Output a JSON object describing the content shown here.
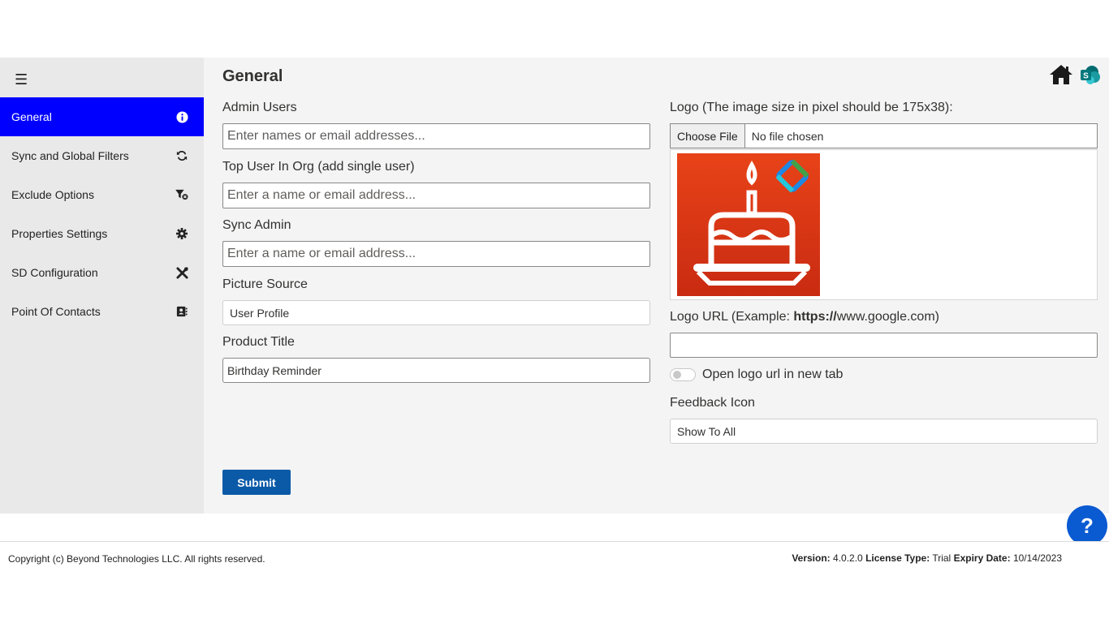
{
  "sidebar": {
    "menu_icon": "hamburger-menu-icon",
    "items": [
      {
        "label": "General",
        "icon": "info-icon",
        "active": true
      },
      {
        "label": "Sync and Global Filters",
        "icon": "refresh-icon"
      },
      {
        "label": "Exclude Options",
        "icon": "filter-clear-icon"
      },
      {
        "label": "Properties Settings",
        "icon": "gear-icon"
      },
      {
        "label": "SD Configuration",
        "icon": "tools-icon"
      },
      {
        "label": "Point Of Contacts",
        "icon": "contact-card-icon"
      }
    ]
  },
  "header": {
    "title": "General",
    "icons": [
      "home-icon",
      "sharepoint-icon"
    ],
    "sharepoint_letter": "S"
  },
  "form": {
    "admin_users": {
      "label": "Admin Users",
      "placeholder": "Enter names or email addresses..."
    },
    "top_user": {
      "label": "Top User In Org (add single user)",
      "placeholder": "Enter a name or email address..."
    },
    "sync_admin": {
      "label": "Sync Admin",
      "placeholder": "Enter a name or email address..."
    },
    "picture_source": {
      "label": "Picture Source",
      "value": "User Profile"
    },
    "product_title": {
      "label": "Product Title",
      "value": "Birthday Reminder"
    },
    "logo": {
      "label": "Logo (The image size in pixel should be 175x38):",
      "choose_label": "Choose File",
      "no_file_text": "No file chosen",
      "preview_icon": "birthday-cake-icon",
      "preview_bg": "#e84318"
    },
    "logo_url": {
      "label_prefix": "Logo URL (Example: ",
      "label_bold": "https://",
      "label_suffix": "www.google.com)",
      "value": ""
    },
    "open_new_tab": {
      "label": "Open logo url in new tab",
      "checked": false
    },
    "feedback_icon": {
      "label": "Feedback Icon",
      "value": "Show To All"
    },
    "submit_label": "Submit"
  },
  "help": {
    "label": "?",
    "icon": "help-icon"
  },
  "footer": {
    "copyright": "Copyright (c) Beyond Technologies LLC. All rights reserved.",
    "version_label": "Version:",
    "version_value": "4.0.2.0",
    "license_label": "License Type:",
    "license_value": "Trial",
    "expiry_label": "Expiry Date:",
    "expiry_value": "10/14/2023"
  },
  "colors": {
    "active_nav": "#0000ff",
    "submit": "#0a5aa8",
    "help": "#0a5ad2"
  }
}
